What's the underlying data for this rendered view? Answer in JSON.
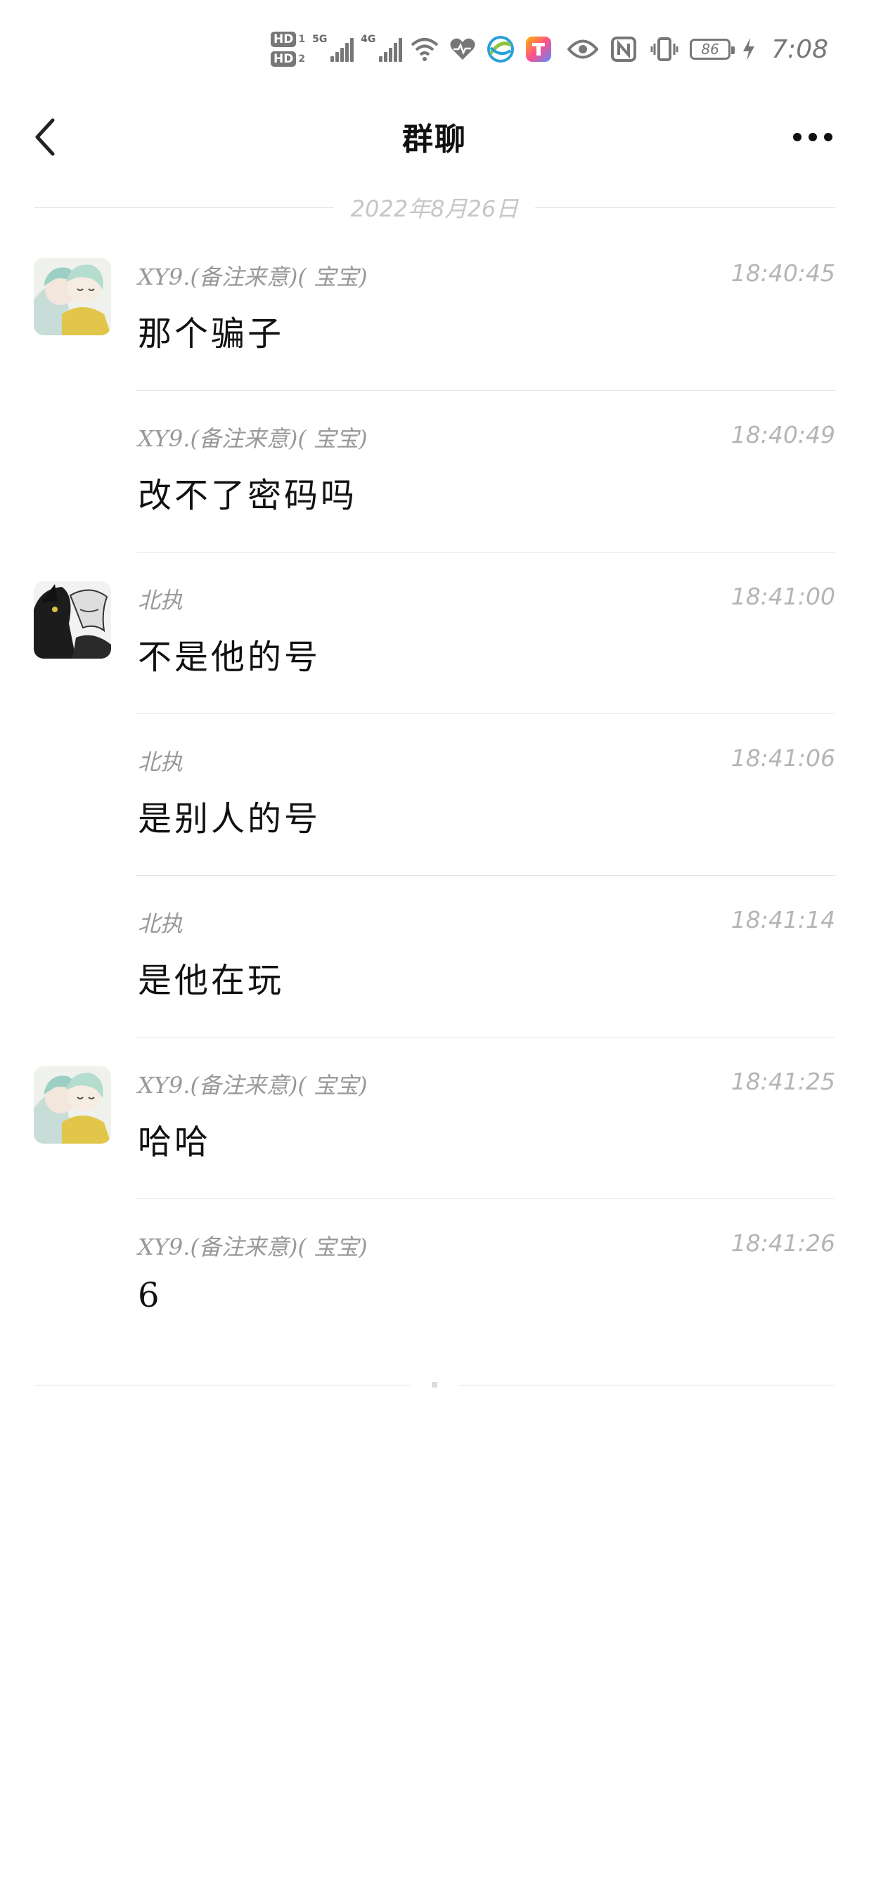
{
  "status_bar": {
    "hd1": "HD",
    "hd1_num": "1",
    "hd2": "HD",
    "hd2_num": "2",
    "sim1_network": "5G",
    "sim2_network": "4G",
    "battery": "86",
    "time": "7:08"
  },
  "header": {
    "title": "群聊",
    "back_icon": "chevron-left-icon",
    "more_icon": "more-dots-icon"
  },
  "date_divider": "2022年8月26日",
  "messages": [
    {
      "sender": "XY9.(备注来意)(   宝宝)",
      "time": "18:40:45",
      "text": "那个骗子",
      "avatar": "anime-couple-avatar"
    },
    {
      "sender": "XY9.(备注来意)(   宝宝)",
      "time": "18:40:49",
      "text": "改不了密码吗"
    },
    {
      "sender": "北执",
      "time": "18:41:00",
      "text": "不是他的号",
      "avatar": "dark-wolf-avatar"
    },
    {
      "sender": "北执",
      "time": "18:41:06",
      "text": "是别人的号"
    },
    {
      "sender": "北执",
      "time": "18:41:14",
      "text": "是他在玩"
    },
    {
      "sender": "XY9.(备注来意)(   宝宝)",
      "time": "18:41:25",
      "text": "哈哈",
      "avatar": "anime-couple-avatar"
    },
    {
      "sender": "XY9.(备注来意)(   宝宝)",
      "time": "18:41:26",
      "text": "6"
    }
  ],
  "colors": {
    "meta_text": "#999999",
    "time_text": "#b5b5b5",
    "divider": "#e5e5e5"
  }
}
